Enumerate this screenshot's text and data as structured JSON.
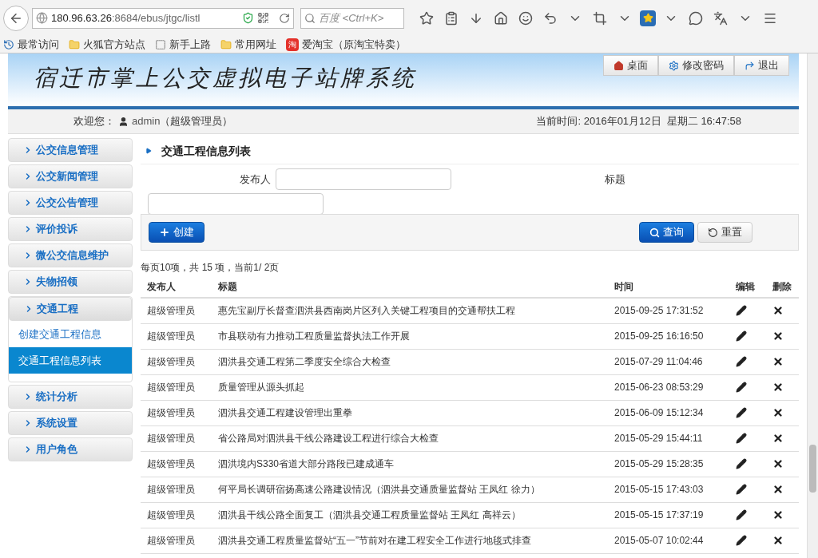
{
  "browser": {
    "url_host": "180.96.63.26",
    "url_path": ":8684/ebus/jtgc/listl",
    "search_placeholder": "百度 <Ctrl+K>"
  },
  "bookmarks": [
    {
      "label": "最常访问",
      "kind": "history"
    },
    {
      "label": "火狐官方站点",
      "kind": "folder"
    },
    {
      "label": "新手上路",
      "kind": "dashed"
    },
    {
      "label": "常用网址",
      "kind": "folder"
    },
    {
      "label": "爱淘宝（原淘宝特卖）",
      "kind": "taobao",
      "badge": "淘"
    }
  ],
  "header": {
    "title": "宿迁市掌上公交虚拟电子站牌系统",
    "buttons": [
      {
        "label": "桌面",
        "kind": "home"
      },
      {
        "label": "修改密码",
        "kind": "gear"
      },
      {
        "label": "退出",
        "kind": "exit"
      }
    ]
  },
  "welcome": {
    "label": "欢迎您：",
    "user": "admin",
    "role": "（超级管理员）",
    "time": "当前时间: 2016年01月12日  星期二 16:47:58"
  },
  "sidebar": {
    "items": [
      {
        "label": "公交信息管理",
        "expanded": false
      },
      {
        "label": "公交新闻管理",
        "expanded": false
      },
      {
        "label": "公交公告管理",
        "expanded": false
      },
      {
        "label": "评价投诉",
        "expanded": false
      },
      {
        "label": "微公交信息维护",
        "expanded": false
      },
      {
        "label": "失物招领",
        "expanded": false
      },
      {
        "label": "交通工程",
        "expanded": true,
        "children": [
          {
            "label": "创建交通工程信息",
            "selected": false
          },
          {
            "label": "交通工程信息列表",
            "selected": true
          }
        ]
      },
      {
        "label": "统计分析",
        "expanded": false
      },
      {
        "label": "系统设置",
        "expanded": false
      },
      {
        "label": "用户角色",
        "expanded": false
      }
    ]
  },
  "main": {
    "title": "交通工程信息列表",
    "filters": [
      {
        "label": "发布人"
      },
      {
        "label": "标题"
      }
    ],
    "buttons": {
      "create": "创建",
      "search": "查询",
      "reset": "重置"
    },
    "pagination": "每页10项，共 15 项，当前1/ 2页",
    "table": {
      "columns": [
        "发布人",
        "标题",
        "时间",
        "编辑",
        "删除"
      ],
      "rows": [
        {
          "publisher": "超级管理员",
          "title": "惠先宝副厅长督查泗洪县西南岗片区列入关键工程项目的交通帮扶工程",
          "time": "2015-09-25 17:31:52"
        },
        {
          "publisher": "超级管理员",
          "title": "市县联动有力推动工程质量监督执法工作开展",
          "time": "2015-09-25 16:16:50"
        },
        {
          "publisher": "超级管理员",
          "title": "泗洪县交通工程第二季度安全综合大检查",
          "time": "2015-07-29 11:04:46"
        },
        {
          "publisher": "超级管理员",
          "title": "质量管理从源头抓起",
          "time": "2015-06-23 08:53:29"
        },
        {
          "publisher": "超级管理员",
          "title": "泗洪县交通工程建设管理出重拳",
          "time": "2015-06-09 15:12:34"
        },
        {
          "publisher": "超级管理员",
          "title": "省公路局对泗洪县干线公路建设工程进行综合大检查",
          "time": "2015-05-29 15:44:11"
        },
        {
          "publisher": "超级管理员",
          "title": "泗洪境内S330省道大部分路段已建成通车",
          "time": "2015-05-29 15:28:35"
        },
        {
          "publisher": "超级管理员",
          "title": "何平局长调研宿扬高速公路建设情况（泗洪县交通质量监督站 王凤红 徐力）",
          "time": "2015-05-15 17:43:03"
        },
        {
          "publisher": "超级管理员",
          "title": "泗洪县干线公路全面复工（泗洪县交通工程质量监督站 王凤红 高祥云）",
          "time": "2015-05-15 17:37:19"
        },
        {
          "publisher": "超级管理员",
          "title": "泗洪县交通工程质量监督站“五一”节前对在建工程安全工作进行地毯式排查",
          "time": "2015-05-07 10:02:44"
        }
      ]
    }
  }
}
